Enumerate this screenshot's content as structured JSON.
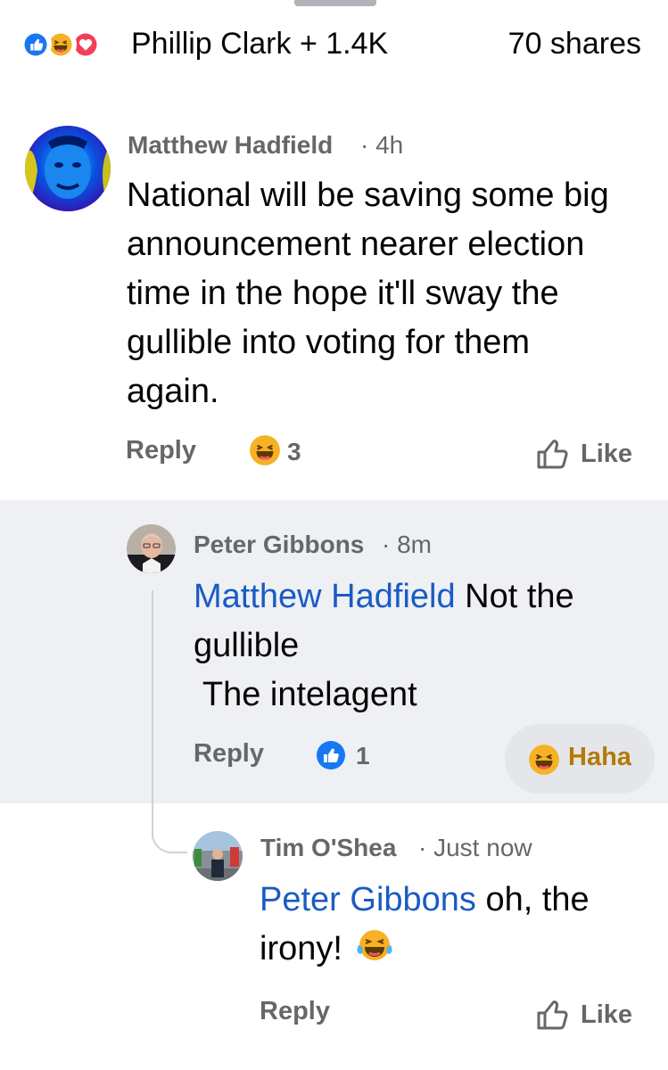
{
  "summary": {
    "reaction_icons": [
      "like-icon",
      "haha-icon",
      "love-icon"
    ],
    "names": "Phillip Clark + 1.4K",
    "shares": "70 shares"
  },
  "comments": [
    {
      "author": "Matthew Hadfield",
      "time": "4h",
      "text": "National will be saving some big announcement nearer election time in the hope it'll sway the gullible into voting for them again.",
      "reply_label": "Reply",
      "reaction_icon": "haha-icon",
      "reaction_count": "3",
      "like_label": "Like"
    },
    {
      "author": "Peter Gibbons",
      "time": "8m",
      "mention": "Matthew Hadfield",
      "text_line1": "Not the",
      "text_line2": "gullible",
      "text_line3": " The intelagent",
      "reply_label": "Reply",
      "reaction_icon": "like-icon",
      "reaction_count": "1",
      "my_reaction_label": "Haha"
    },
    {
      "author": "Tim O'Shea",
      "time": "Just now",
      "mention": "Peter Gibbons",
      "text_line1": "oh, the",
      "text_line2": "irony!",
      "emoji": "laugh-tears-emoji",
      "reply_label": "Reply",
      "like_label": "Like"
    }
  ],
  "colors": {
    "mention": "#1a5bc4",
    "meta": "#65676b",
    "like_blue": "#1877f2",
    "love_red": "#f33e58",
    "haha_yellow": "#f7b125",
    "haha_text": "#b47a05",
    "reply_highlight_bg": "#eef0f3"
  }
}
